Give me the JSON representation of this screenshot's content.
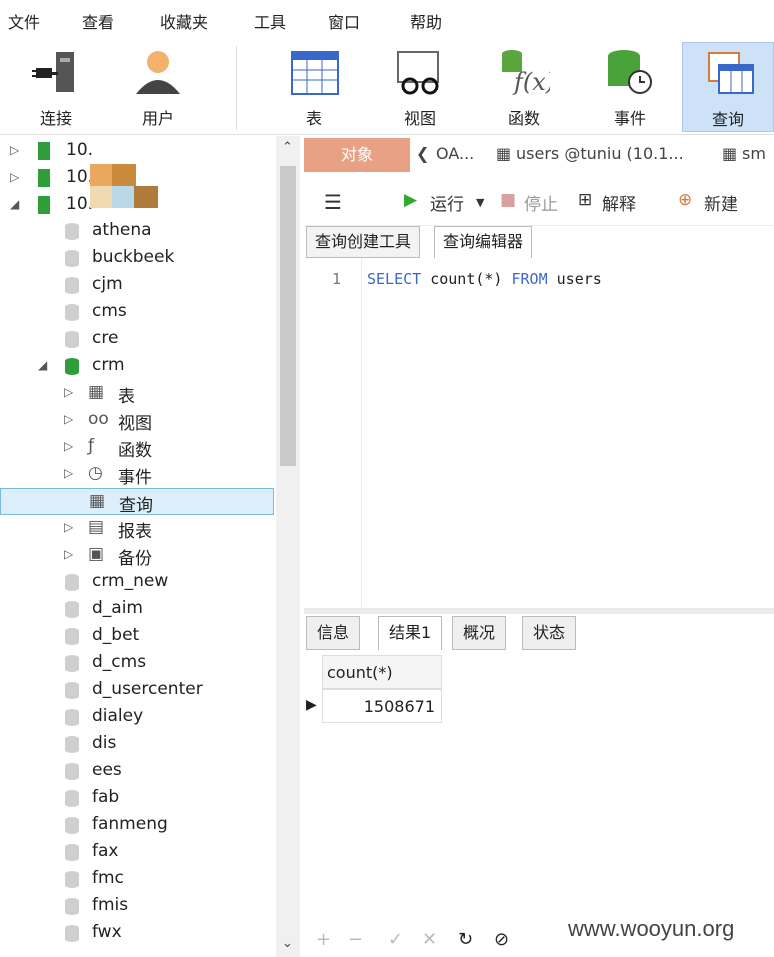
{
  "menu": [
    "文件",
    "查看",
    "收藏夹",
    "工具",
    "窗口",
    "帮助"
  ],
  "toolbar": {
    "connect": "连接",
    "user": "用户",
    "table": "表",
    "view": "视图",
    "function": "函数",
    "event": "事件",
    "query": "查询"
  },
  "tree": {
    "servers": [
      "10.",
      "10.",
      "10."
    ],
    "databases_top": [
      "athena",
      "buckbeek",
      "cjm",
      "cms",
      "cre"
    ],
    "crm": "crm",
    "crm_children": [
      "表",
      "视图",
      "函数",
      "事件",
      "查询",
      "报表",
      "备份"
    ],
    "databases_bottom": [
      "crm_new",
      "d_aim",
      "d_bet",
      "d_cms",
      "d_usercenter",
      "dialey",
      "dis",
      "ees",
      "fab",
      "fanmeng",
      "fax",
      "fmc",
      "fmis",
      "fwx"
    ]
  },
  "tabs": {
    "objects": "对象",
    "tab1": "OA...",
    "tab2": "users @tuniu (10.1...",
    "tab3": "sm"
  },
  "query_toolbar": {
    "run": "运行",
    "stop": "停止",
    "explain": "解释",
    "new": "新建"
  },
  "subtabs": {
    "builder": "查询创建工具",
    "editor": "查询编辑器"
  },
  "editor": {
    "line_number": "1",
    "kw1": "SELECT",
    "part1": " count(*) ",
    "kw2": "FROM",
    "part2": " users"
  },
  "result_tabs": [
    "信息",
    "结果1",
    "概况",
    "状态"
  ],
  "grid": {
    "column": "count(*)",
    "value": "1508671"
  },
  "watermark": "www.wooyun.org",
  "colors": {
    "accent": "#3a68c8",
    "object_tab": "#e8a184",
    "db_green": "#2e9e3b"
  }
}
